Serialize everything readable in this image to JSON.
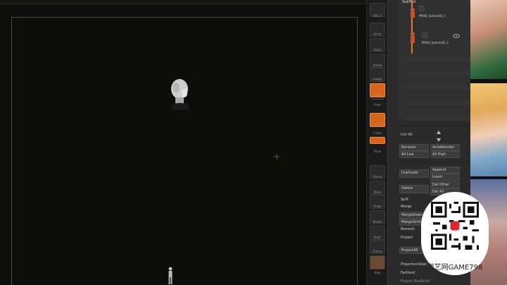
{
  "shelf": {
    "items": [
      {
        "label": "SPix 3"
      },
      {
        "label": "Scroll"
      },
      {
        "label": "Zoom"
      },
      {
        "label": "Actual"
      },
      {
        "label": "AAHalf"
      },
      {
        "label": "Persp"
      },
      {
        "label": "Floor"
      },
      {
        "label": "Local"
      },
      {
        "label": "L.Sym"
      },
      {
        "label": "Gxyz"
      },
      {
        "label": "Frame"
      },
      {
        "label": "Move"
      },
      {
        "label": "Scale"
      },
      {
        "label": "Rotate"
      },
      {
        "label": "PolyF"
      },
      {
        "label": "Transp"
      },
      {
        "label": "Solo"
      }
    ]
  },
  "subtool": {
    "title": "SubTool",
    "items": [
      {
        "name": "PM3D_Sphere3D_1"
      },
      {
        "name": "PM3D_Sphere3D_2"
      }
    ]
  },
  "palette": {
    "list_all": "List All",
    "rename": "Rename",
    "auto_reorder": "AutoReorder",
    "all_low": "All Low",
    "all_high": "All High",
    "duplicate": "Duplicate",
    "append": "Append",
    "insert": "Insert",
    "delete": "Delete",
    "del_other": "Del Other",
    "del_all": "Del All",
    "split": "Split",
    "merge": "Merge",
    "merge_down": "MergeDown",
    "merge_similar": "MergeSimilar",
    "remesh": "Remesh",
    "project": "Project",
    "project_all": "ProjectAll",
    "projection_shell": "ProjectionShell",
    "farthest": "Farthest",
    "extract": "Extract",
    "project_bas_relief": "Project BasRelief"
  },
  "watermark": {
    "caption": "游艺网GAME798"
  },
  "colors": {
    "accent": "#e07a28",
    "canvas": "#0d0d0a",
    "panel": "#2a2a2a"
  }
}
